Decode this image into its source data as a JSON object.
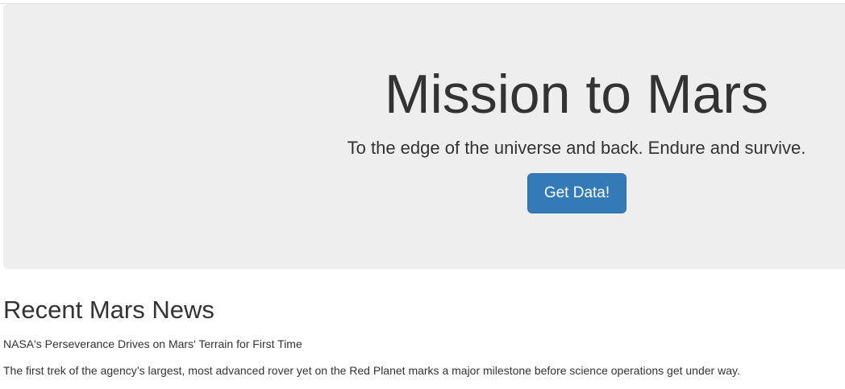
{
  "hero": {
    "title": "Mission to Mars",
    "subtitle": "To the edge of the universe and back. Endure and survive.",
    "button_label": "Get Data!"
  },
  "news": {
    "heading": "Recent Mars News",
    "title": "NASA's Perseverance Drives on Mars' Terrain for First Time",
    "paragraph": "The first trek of the agency’s largest, most advanced rover yet on the Red Planet marks a major milestone before science operations get under way."
  },
  "colors": {
    "jumbotron_background": "#eeeeee",
    "button_background": "#337ab7",
    "button_text": "#ffffff",
    "text": "#333333"
  }
}
